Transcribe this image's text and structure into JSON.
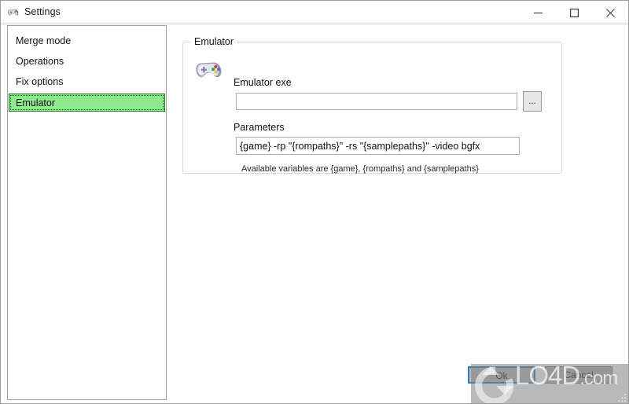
{
  "window": {
    "title": "Settings",
    "icon": "gamepad-icon",
    "controls": {
      "minimize": "minimize-icon",
      "maximize": "maximize-icon",
      "close": "close-icon"
    }
  },
  "sidebar": {
    "items": [
      {
        "label": "Merge mode",
        "selected": false
      },
      {
        "label": "Operations",
        "selected": false
      },
      {
        "label": "Fix options",
        "selected": false
      },
      {
        "label": "Emulator",
        "selected": true
      }
    ],
    "selected_color": "#8ce98c"
  },
  "main": {
    "group": {
      "title": "Emulator",
      "icon": "gamepad-icon",
      "fields": [
        {
          "label": "Emulator exe",
          "value": "",
          "placeholder": "",
          "browse_label": "..."
        },
        {
          "label": "Parameters",
          "value": "{game} -rp \"{rompaths}\" -rs \"{samplepaths}\" -video bgfx",
          "placeholder": ""
        }
      ],
      "hint": "Available variables are {game}, {rompaths} and {samplepaths}"
    }
  },
  "footer": {
    "ok_label": "Ok",
    "cancel_label": "Cancel"
  },
  "watermark": {
    "text": "LO4D",
    "suffix": ".com"
  }
}
